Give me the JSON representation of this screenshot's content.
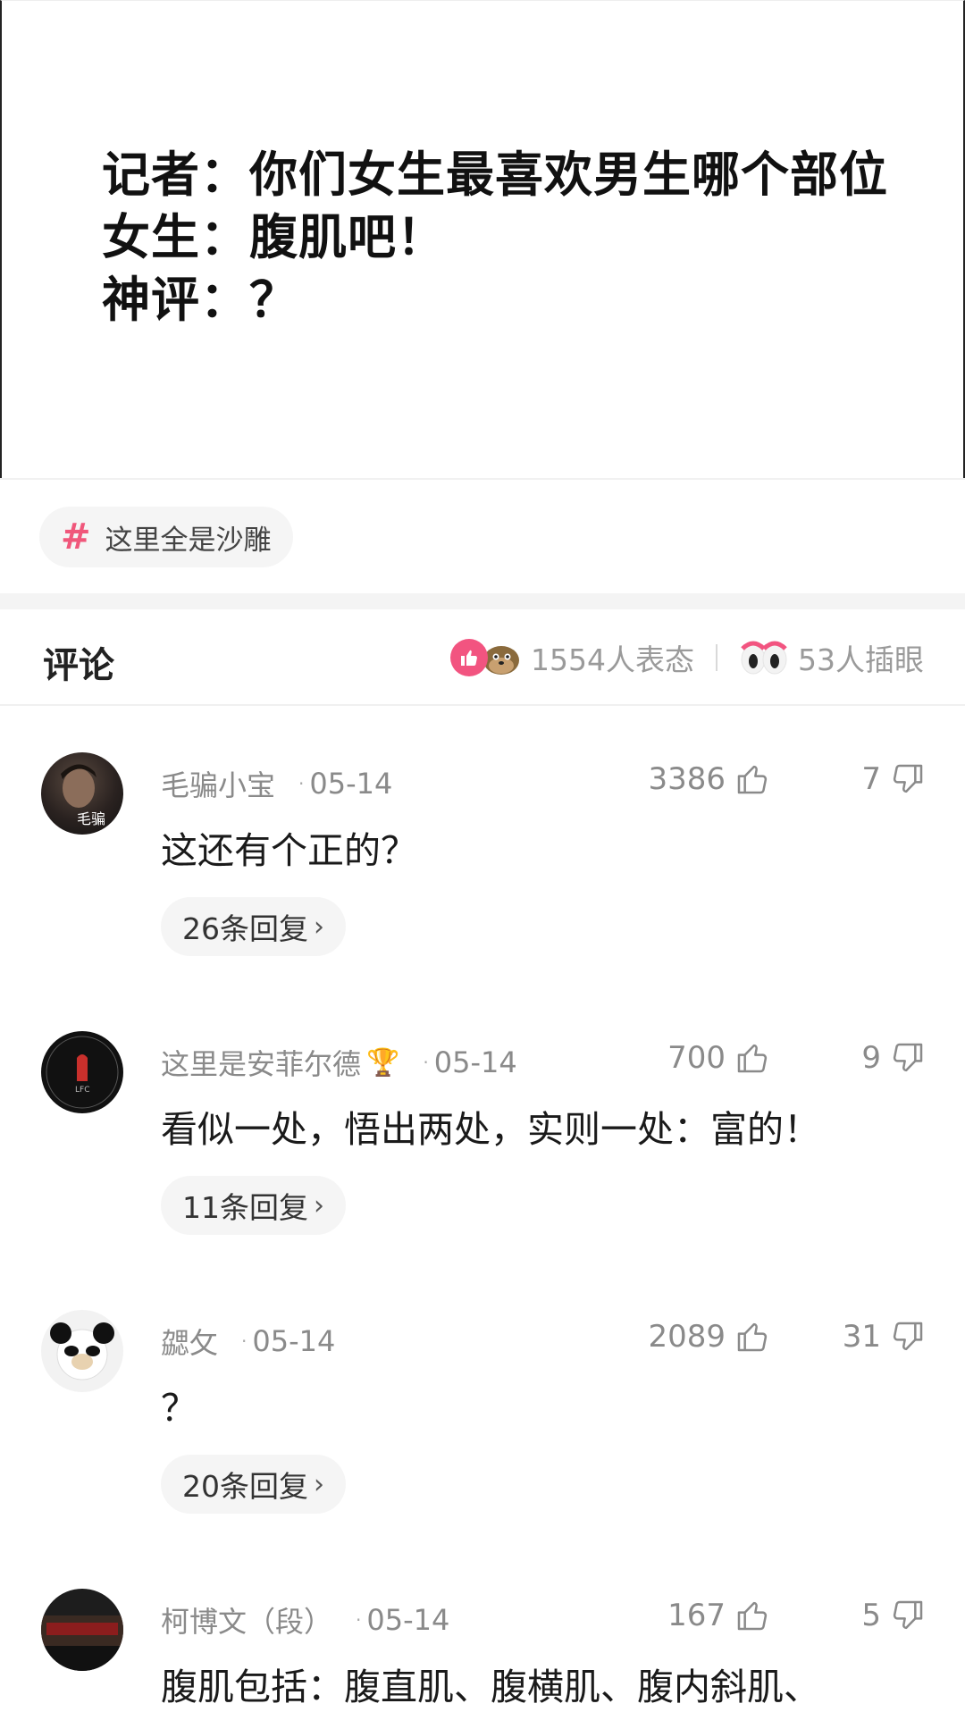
{
  "post": {
    "lines": [
      "记者：你们女生最喜欢男生哪个部位",
      "女生：腹肌吧！",
      "神评：？"
    ]
  },
  "topic": {
    "icon": "hash-icon",
    "label": "这里全是沙雕"
  },
  "comments_header": {
    "title": "评论",
    "reactions_count": "1554人表态",
    "peek_count": "53人插眼"
  },
  "comments": [
    {
      "user": "毛骗小宝",
      "date": "05-14",
      "likes": "3386",
      "dislikes": "7",
      "text": "这还有个正的？",
      "replies": "26条回复",
      "badge": ""
    },
    {
      "user": "这里是安菲尔德",
      "date": "05-14",
      "likes": "700",
      "dislikes": "9",
      "text": "看似一处，悟出两处，实则一处：富的！",
      "replies": "11条回复",
      "badge": "trophy-icon"
    },
    {
      "user": "勰攵",
      "date": "05-14",
      "likes": "2089",
      "dislikes": "31",
      "text": "？",
      "replies": "20条回复",
      "badge": ""
    },
    {
      "user": "柯博文（段）",
      "date": "05-14",
      "likes": "167",
      "dislikes": "5",
      "text": "腹肌包括：腹直肌、腹横肌、腹内斜肌、",
      "replies": "",
      "badge": ""
    }
  ],
  "colors": {
    "accent": "#f25480",
    "hash": "#f0577b",
    "muted": "#8a8a8a"
  }
}
